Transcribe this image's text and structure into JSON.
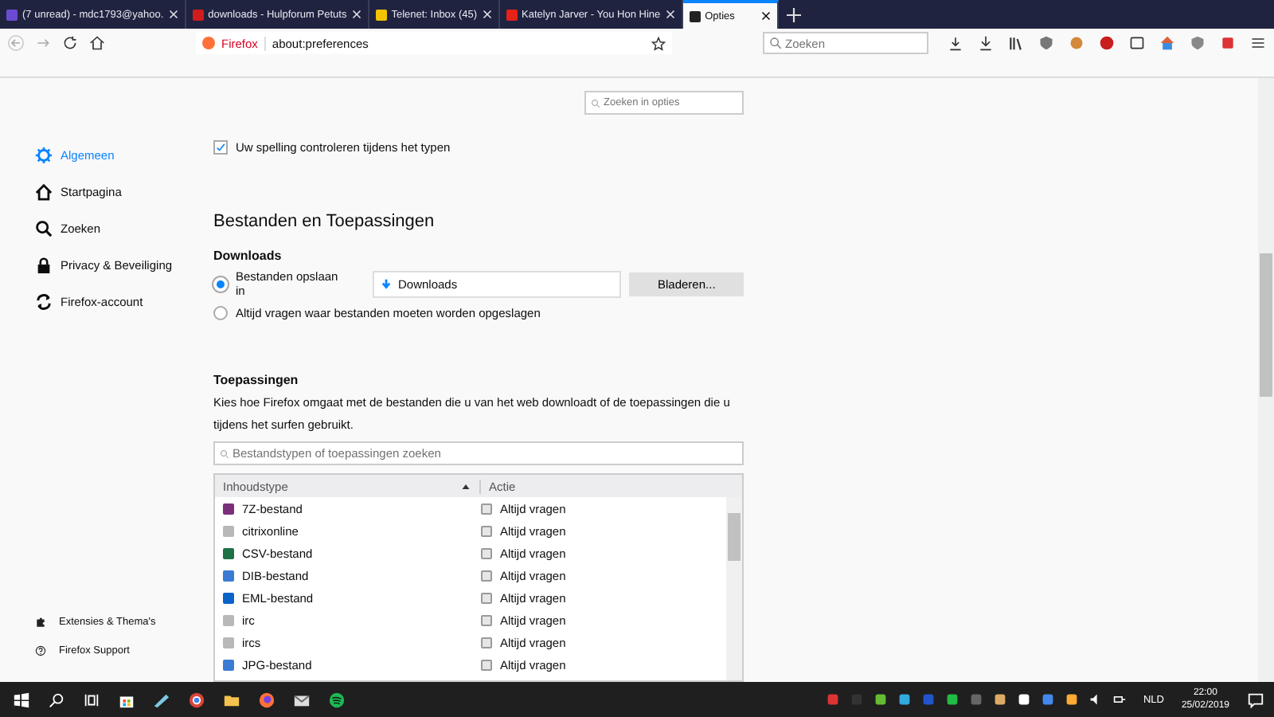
{
  "tabs": [
    {
      "title": "(7 unread) - mdc1793@yahoo.",
      "selected": false
    },
    {
      "title": "downloads - Hulpforum Petuts",
      "selected": false
    },
    {
      "title": "Telenet: Inbox (45)",
      "selected": false
    },
    {
      "title": "Katelyn Jarver - You Hon Hine",
      "selected": false
    },
    {
      "title": "Opties",
      "selected": true
    }
  ],
  "toolbar": {
    "identity": "Firefox",
    "url": "about:preferences",
    "search_placeholder": "Zoeken"
  },
  "options_search": {
    "placeholder": "Zoeken in opties"
  },
  "sidebar": {
    "items": [
      {
        "label": "Algemeen",
        "selected": true
      },
      {
        "label": "Startpagina",
        "selected": false
      },
      {
        "label": "Zoeken",
        "selected": false
      },
      {
        "label": "Privacy & Beveiliging",
        "selected": false
      },
      {
        "label": "Firefox-account",
        "selected": false
      }
    ],
    "footer": [
      "Extensies & Thema's",
      "Firefox Support"
    ]
  },
  "spelling": {
    "label": "Uw spelling controleren tijdens het typen",
    "checked": true
  },
  "section_title": "Bestanden en Toepassingen",
  "downloads": {
    "title": "Downloads",
    "options": [
      {
        "label": "Bestanden opslaan in",
        "selected": true
      },
      {
        "label": "Altijd vragen waar bestanden moeten worden opgeslagen",
        "selected": false
      }
    ],
    "folder": "Downloads",
    "browse": "Bladeren..."
  },
  "applications": {
    "title": "Toepassingen",
    "description": "Kies hoe Firefox omgaat met de bestanden die u van het web downloadt of de toepassingen die u tijdens het surfen gebruikt.",
    "search_placeholder": "Bestandstypen of toepassingen zoeken",
    "columns": [
      "Inhoudstype",
      "Actie"
    ],
    "rows": [
      {
        "type": "7Z-bestand",
        "kind": "archive",
        "action": "Altijd vragen"
      },
      {
        "type": "citrixonline",
        "kind": "generic",
        "action": "Altijd vragen"
      },
      {
        "type": "CSV-bestand",
        "kind": "spreadsheet",
        "action": "Altijd vragen"
      },
      {
        "type": "DIB-bestand",
        "kind": "image",
        "action": "Altijd vragen"
      },
      {
        "type": "EML-bestand",
        "kind": "mail",
        "action": "Altijd vragen"
      },
      {
        "type": "irc",
        "kind": "generic",
        "action": "Altijd vragen"
      },
      {
        "type": "ircs",
        "kind": "generic",
        "action": "Altijd vragen"
      },
      {
        "type": "JPG-bestand",
        "kind": "image",
        "action": "Altijd vragen"
      }
    ]
  },
  "taskbar": {
    "language": "NLD",
    "time": "22:00",
    "date": "25/02/2019"
  }
}
